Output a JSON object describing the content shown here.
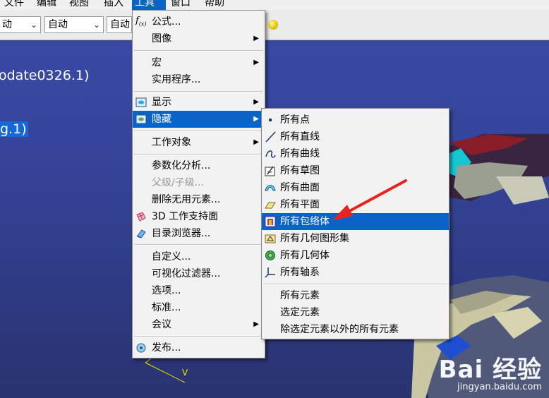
{
  "menubar": {
    "items": [
      {
        "label": "文件"
      },
      {
        "label": "编辑"
      },
      {
        "label": "视图"
      },
      {
        "label": "插入"
      },
      {
        "label": "工具"
      },
      {
        "label": "窗口"
      },
      {
        "label": "帮助"
      }
    ]
  },
  "toolbar": {
    "combo1": "动",
    "combo2": "自动",
    "combo3": "自动"
  },
  "tree": {
    "line1": "odate0326.1)",
    "line2": "g.1)"
  },
  "axis": {
    "label": "V"
  },
  "tools_menu": {
    "items": [
      {
        "label": "公式..."
      },
      {
        "label": "图像"
      },
      {
        "label": "宏"
      },
      {
        "label": "实用程序..."
      },
      {
        "label": "显示"
      },
      {
        "label": "隐藏"
      },
      {
        "label": "工作对象"
      },
      {
        "label": "参数化分析..."
      },
      {
        "label": "父级/子级..."
      },
      {
        "label": "删除无用元素..."
      },
      {
        "label": "3D 工作支持面"
      },
      {
        "label": "目录浏览器..."
      },
      {
        "label": "自定义..."
      },
      {
        "label": "可视化过滤器..."
      },
      {
        "label": "选项..."
      },
      {
        "label": "标准..."
      },
      {
        "label": "会议"
      },
      {
        "label": "发布..."
      }
    ]
  },
  "hide_submenu": {
    "items": [
      {
        "label": "所有点"
      },
      {
        "label": "所有直线"
      },
      {
        "label": "所有曲线"
      },
      {
        "label": "所有草图"
      },
      {
        "label": "所有曲面"
      },
      {
        "label": "所有平面"
      },
      {
        "label": "所有包络体"
      },
      {
        "label": "所有几何图形集"
      },
      {
        "label": "所有几何体"
      },
      {
        "label": "所有轴系"
      },
      {
        "label": "所有元素"
      },
      {
        "label": "选定元素"
      },
      {
        "label": "除选定元素以外的所有元素"
      }
    ]
  },
  "watermark": {
    "main": "Bai 经验",
    "sub": "jingyan.baidu.com"
  },
  "colors": {
    "highlight": "#0a64c8",
    "viewport": "#36459b",
    "arrow": "#e8231d"
  }
}
